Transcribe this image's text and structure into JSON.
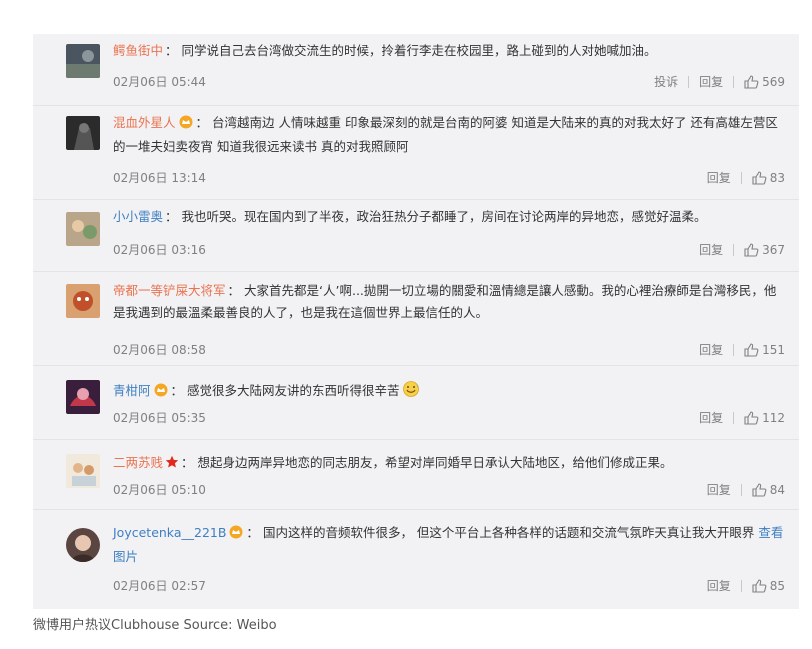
{
  "comments": [
    {
      "user": "鳄鱼街中",
      "badge": "",
      "text": "同学说自己去台湾做交流生的时候，拎着行李走在校园里，路上碰到的人对她喊加油。",
      "link": "",
      "time": "02月06日 05:44",
      "report": "投诉",
      "reply": "回复",
      "likes": "569"
    },
    {
      "user": "混血外星人",
      "badge": "gold-crown-icon",
      "text": "台湾越南边 人情味越重 印象最深刻的就是台南的阿婆 知道是大陆来的真的对我太好了 还有高雄左营区的一堆夫妇卖夜宵 知道我很远来读书 真的对我照顾阿",
      "link": "",
      "time": "02月06日 13:14",
      "report": "",
      "reply": "回复",
      "likes": "83"
    },
    {
      "user": "小小雷奥",
      "badge": "",
      "text": "我也听哭。现在国内到了半夜，政治狂热分子都睡了，房间在讨论两岸的异地恋，感觉好温柔。",
      "link": "",
      "time": "02月06日 03:16",
      "report": "",
      "reply": "回复",
      "likes": "367"
    },
    {
      "user": "帝都一等铲屎大将军",
      "badge": "",
      "text": "大家首先都是‘人’啊...拋開一切立場的關愛和溫情總是讓人感動。我的心裡治療師是台灣移民，他是我遇到的最溫柔最善良的人了，也是我在這個世界上最信任的人。",
      "link": "",
      "time": "02月06日 08:58",
      "report": "",
      "reply": "回复",
      "likes": "151"
    },
    {
      "user": "青柑阿",
      "badge": "gold-crown-icon",
      "text": "感觉很多大陆网友讲的东西听得很辛苦",
      "link": "",
      "time": "02月06日 05:35",
      "report": "",
      "reply": "回复",
      "likes": "112"
    },
    {
      "user": "二两苏贱",
      "badge": "red-star-icon",
      "text": "想起身边两岸异地恋的同志朋友，希望对岸同婚早日承认大陆地区，给他们修成正果。",
      "link": "",
      "time": "02月06日 05:10",
      "report": "",
      "reply": "回复",
      "likes": "84"
    },
    {
      "user": "Joycetenka__221B",
      "badge": "gold-crown-icon",
      "text": "国内这样的音频软件很多， 但这个平台上各种各样的话题和交流气氛昨天真让我大开眼界",
      "link": "查看图片",
      "time": "02月06日 02:57",
      "report": "",
      "reply": "回复",
      "likes": "85"
    }
  ],
  "caption": "微博用户热议Clubhouse Source: Weibo",
  "colors": {
    "username": "#eb7350",
    "link": "#3f7fc1",
    "panel_bg": "#f2f2f5",
    "badge_gold": "#f5a623"
  }
}
